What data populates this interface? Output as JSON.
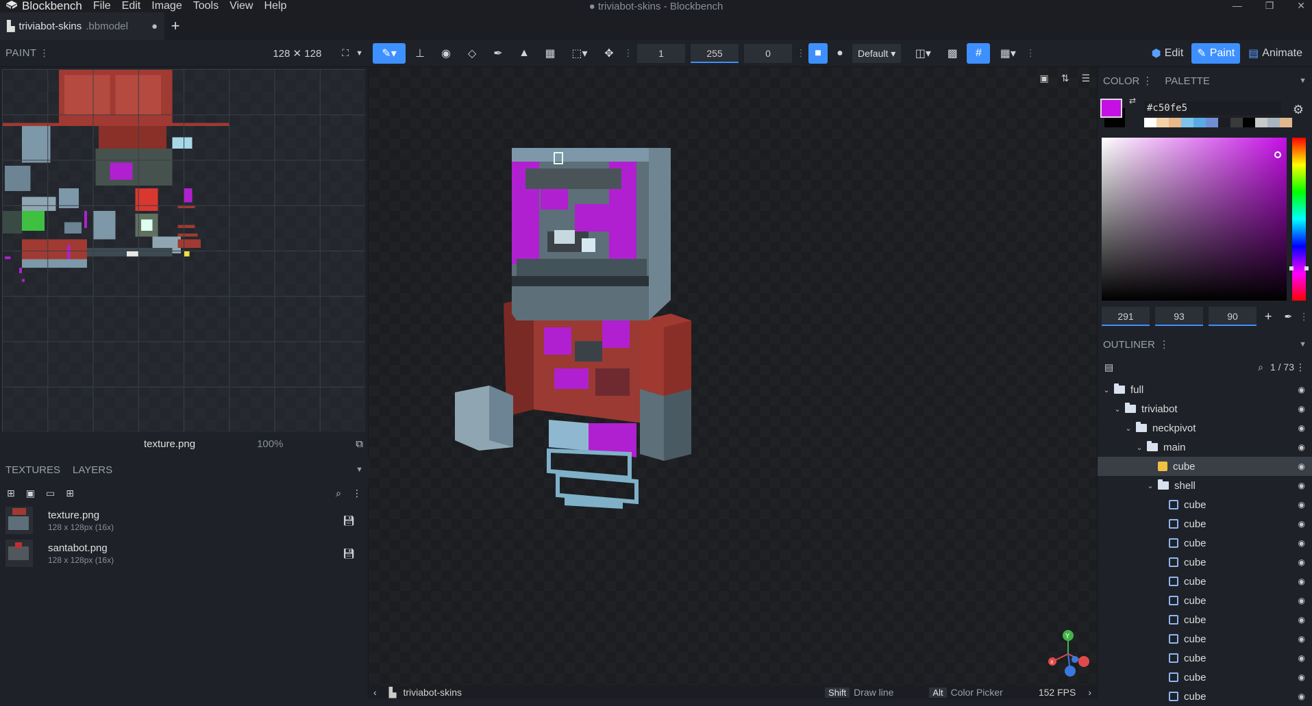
{
  "app": {
    "name": "Blockbench",
    "window_title": "● triviabot-skins - Blockbench"
  },
  "menu": [
    "File",
    "Edit",
    "Image",
    "Tools",
    "View",
    "Help"
  ],
  "tab": {
    "name": "triviabot-skins",
    "ext": ".bbmodel",
    "dirty": "●"
  },
  "toolbar": {
    "panel": "PAINT",
    "resolution": "128 ✕ 128",
    "size": "1",
    "opacity": "255",
    "softness": "0",
    "blend_mode": "Default",
    "modes": {
      "edit": "Edit",
      "paint": "Paint",
      "animate": "Animate"
    }
  },
  "uv": {
    "texture": "texture.png",
    "zoom": "100%"
  },
  "textures_panel": {
    "tabs": [
      "TEXTURES",
      "LAYERS"
    ],
    "items": [
      {
        "name": "texture.png",
        "info": "128 x 128px (16x)"
      },
      {
        "name": "santabot.png",
        "info": "128 x 128px (16x)"
      }
    ]
  },
  "color_panel": {
    "tabs": [
      "COLOR",
      "PALETTE"
    ],
    "hex": "#c50fe5",
    "h": "291",
    "s": "93",
    "v": "90",
    "primary": "#c50fe5",
    "palette": [
      "#ffffff",
      "#f2d3a9",
      "#e8b88a",
      "#7ec3ea",
      "#5aa9e6",
      "#6f8ed6",
      "#1b1d22",
      "#3a3a3a",
      "#000000",
      "#c8c8c8",
      "#aab4bf",
      "#e0b890"
    ]
  },
  "outliner": {
    "title": "OUTLINER",
    "count": "1 / 73",
    "rows": [
      {
        "label": "full",
        "type": "folder",
        "depth": 0
      },
      {
        "label": "triviabot",
        "type": "folder",
        "depth": 1
      },
      {
        "label": "neckpivot",
        "type": "folder",
        "depth": 2
      },
      {
        "label": "main",
        "type": "folder",
        "depth": 3
      },
      {
        "label": "cube",
        "type": "cube-selected",
        "depth": 4
      },
      {
        "label": "shell",
        "type": "folder",
        "depth": 4
      },
      {
        "label": "cube",
        "type": "cube",
        "depth": 5
      },
      {
        "label": "cube",
        "type": "cube",
        "depth": 5
      },
      {
        "label": "cube",
        "type": "cube",
        "depth": 5
      },
      {
        "label": "cube",
        "type": "cube",
        "depth": 5
      },
      {
        "label": "cube",
        "type": "cube",
        "depth": 5
      },
      {
        "label": "cube",
        "type": "cube",
        "depth": 5
      },
      {
        "label": "cube",
        "type": "cube",
        "depth": 5
      },
      {
        "label": "cube",
        "type": "cube",
        "depth": 5
      },
      {
        "label": "cube",
        "type": "cube",
        "depth": 5
      },
      {
        "label": "cube",
        "type": "cube",
        "depth": 5
      },
      {
        "label": "cube",
        "type": "cube",
        "depth": 5
      }
    ]
  },
  "status": {
    "project": "triviabot-skins",
    "hint1_key": "Shift",
    "hint1": "Draw line",
    "hint2_key": "Alt",
    "hint2": "Color Picker",
    "fps": "152 FPS"
  }
}
